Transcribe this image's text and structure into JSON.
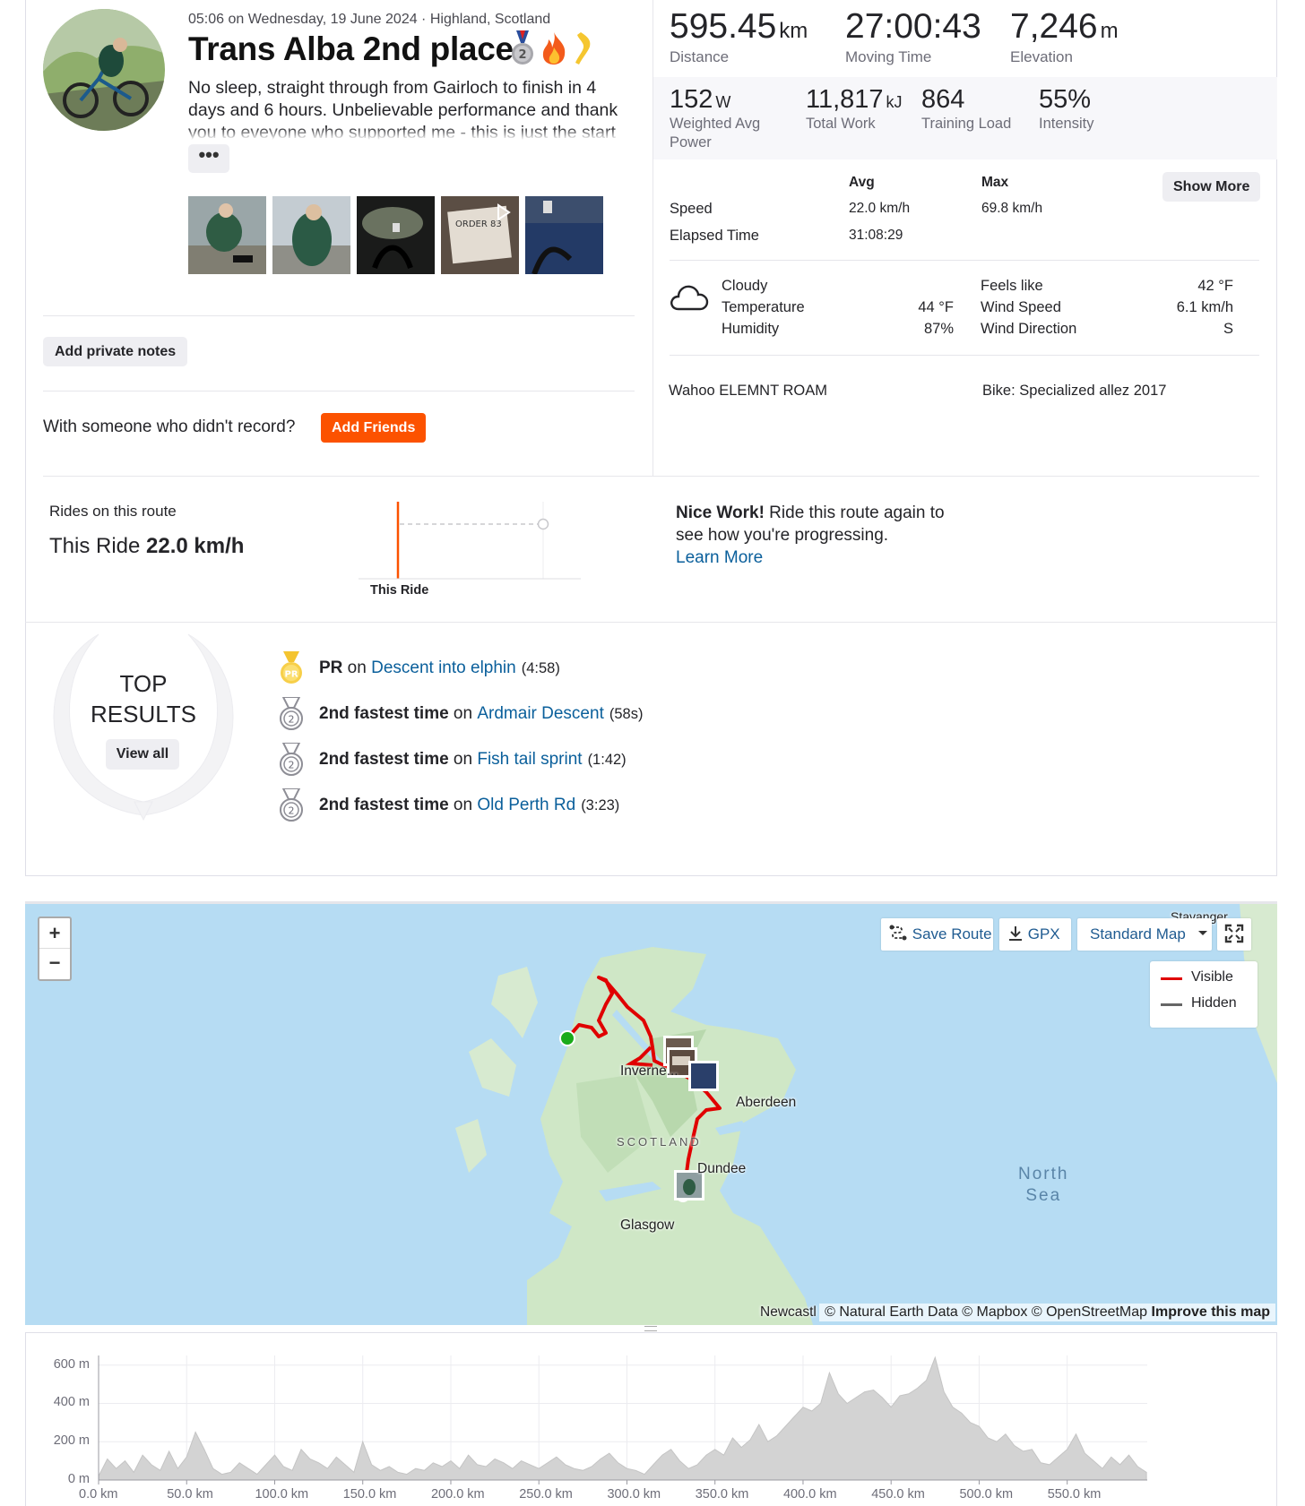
{
  "header": {
    "meta": "05:06 on Wednesday, 19 June 2024 · Highland, Scotland",
    "title": "Trans Alba 2nd place",
    "title_icons": [
      "silver-medal-2-icon",
      "fire-icon",
      "flexed-leg-icon"
    ],
    "description": "No sleep, straight through from Gairloch to finish in 4 days and 6 hours. Unbelievable performance and thank you to eveyone who supported me - this is just the start",
    "more_label": "•••",
    "photos": [
      "photo-rider-seated",
      "photo-rider-jacket",
      "photo-night-bars",
      "photo-order-83-video",
      "photo-loch-bars"
    ]
  },
  "actions": {
    "private_notes": "Add private notes",
    "with_someone": "With someone who didn't record?",
    "add_friends": "Add Friends"
  },
  "stats": {
    "primary": [
      {
        "value": "595.45",
        "unit": "km",
        "label": "Distance"
      },
      {
        "value": "27:00:43",
        "unit": "",
        "label": "Moving Time"
      },
      {
        "value": "7,246",
        "unit": "m",
        "label": "Elevation"
      }
    ],
    "secondary": [
      {
        "value": "152",
        "unit": "W",
        "label": "Weighted Avg Power"
      },
      {
        "value": "11,817",
        "unit": "kJ",
        "label": "Total Work"
      },
      {
        "value": "864",
        "unit": "",
        "label": "Training Load"
      },
      {
        "value": "55%",
        "unit": "",
        "label": "Intensity"
      }
    ],
    "table_headers": {
      "avg": "Avg",
      "max": "Max"
    },
    "show_more": "Show More",
    "speed": {
      "label": "Speed",
      "avg": "22.0 km/h",
      "max": "69.8 km/h"
    },
    "elapsed": {
      "label": "Elapsed Time",
      "avg": "31:08:29"
    }
  },
  "weather": {
    "icon": "cloud-icon",
    "condition": "Cloudy",
    "temperature_label": "Temperature",
    "temperature": "44 °F",
    "humidity_label": "Humidity",
    "humidity": "87%",
    "feels_like_label": "Feels like",
    "feels_like": "42 °F",
    "wind_speed_label": "Wind Speed",
    "wind_speed": "6.1 km/h",
    "wind_direction_label": "Wind Direction",
    "wind_direction": "S"
  },
  "gear": {
    "device": "Wahoo ELEMNT ROAM",
    "bike": "Bike: Specialized allez 2017"
  },
  "route": {
    "label": "Rides on this route",
    "this_ride_prefix": "This Ride",
    "this_ride_speed": "22.0 km/h",
    "chart_label": "This Ride",
    "nice_work_bold": "Nice Work!",
    "nice_work_text": " Ride this route again to see how you're progressing.",
    "learn_more": "Learn More"
  },
  "top_results": {
    "title_line1": "TOP",
    "title_line2": "RESULTS",
    "view_all": "View all",
    "items": [
      {
        "medal": "pr-medal-icon",
        "prefix": "PR",
        "on": " on ",
        "segment": "Descent into elphin",
        "time": "(4:58)"
      },
      {
        "medal": "second-place-medal-icon",
        "prefix": "2nd fastest time",
        "on": " on ",
        "segment": "Ardmair Descent",
        "time": "(58s)"
      },
      {
        "medal": "second-place-medal-icon",
        "prefix": "2nd fastest time",
        "on": " on ",
        "segment": "Fish tail sprint",
        "time": "(1:42)"
      },
      {
        "medal": "second-place-medal-icon",
        "prefix": "2nd fastest time",
        "on": " on ",
        "segment": "Old Perth Rd",
        "time": "(3:23)"
      }
    ]
  },
  "map": {
    "zoom_in": "+",
    "zoom_out": "−",
    "save_route": "Save Route",
    "gpx": "GPX",
    "map_style": "Standard Map",
    "legend_visible": "Visible",
    "legend_hidden": "Hidden",
    "places": {
      "inverness": "Inverne...",
      "aberdeen": "Aberdeen",
      "scotland": "SCOTLAND",
      "dundee": "Dundee",
      "glasgow": "Glasgow",
      "north_sea": "North\nSea",
      "stavanger": "Stavanger",
      "newcastle": "Newcastl"
    },
    "attribution": "© Natural Earth Data © Mapbox © OpenStreetMap",
    "improve": "Improve this map",
    "route_color": "#e00000",
    "hidden_color": "#666666"
  },
  "chart_data": {
    "type": "area",
    "title": "",
    "xlabel": "",
    "ylabel": "",
    "x_ticks": [
      "0.0 km",
      "50.0 km",
      "100.0 km",
      "150.0 km",
      "200.0 km",
      "250.0 km",
      "300.0 km",
      "350.0 km",
      "400.0 km",
      "450.0 km",
      "500.0 km",
      "550.0 km"
    ],
    "y_ticks": [
      "0 m",
      "200 m",
      "400 m",
      "600 m"
    ],
    "xlim": [
      0,
      595.45
    ],
    "ylim": [
      0,
      650
    ],
    "grid": true,
    "fill_color": "#d3d3d3",
    "series": [
      {
        "x": [
          0,
          5,
          10,
          15,
          20,
          25,
          30,
          35,
          40,
          45,
          50,
          55,
          60,
          65,
          70,
          75,
          80,
          85,
          90,
          95,
          100,
          105,
          110,
          115,
          120,
          125,
          130,
          135,
          140,
          145,
          150,
          155,
          160,
          165,
          170,
          175,
          180,
          185,
          190,
          195,
          200,
          205,
          210,
          215,
          220,
          225,
          230,
          235,
          240,
          245,
          250,
          255,
          260,
          265,
          270,
          275,
          280,
          285,
          290,
          295,
          300,
          305,
          310,
          315,
          320,
          325,
          330,
          335,
          340,
          345,
          350,
          355,
          360,
          365,
          370,
          375,
          380,
          385,
          390,
          395,
          400,
          405,
          410,
          415,
          420,
          425,
          430,
          435,
          440,
          445,
          450,
          455,
          460,
          465,
          470,
          475,
          480,
          485,
          490,
          495,
          500,
          505,
          510,
          515,
          520,
          525,
          530,
          535,
          540,
          545,
          550,
          555,
          560,
          565,
          570,
          575,
          580,
          585,
          590,
          595
        ],
        "y": [
          20,
          110,
          60,
          100,
          40,
          130,
          80,
          50,
          150,
          60,
          120,
          250,
          160,
          60,
          30,
          40,
          90,
          60,
          30,
          80,
          130,
          70,
          50,
          160,
          110,
          90,
          60,
          120,
          80,
          40,
          200,
          80,
          50,
          70,
          40,
          30,
          60,
          50,
          90,
          70,
          100,
          60,
          130,
          80,
          70,
          110,
          90,
          60,
          100,
          80,
          60,
          90,
          120,
          80,
          60,
          50,
          70,
          110,
          140,
          90,
          60,
          50,
          30,
          80,
          130,
          160,
          100,
          60,
          80,
          130,
          160,
          130,
          220,
          170,
          210,
          290,
          200,
          230,
          280,
          330,
          380,
          360,
          400,
          560,
          450,
          400,
          430,
          460,
          470,
          430,
          380,
          440,
          450,
          480,
          520,
          640,
          460,
          380,
          350,
          300,
          280,
          220,
          200,
          240,
          180,
          150,
          160,
          90,
          80,
          120,
          160,
          240,
          140,
          100,
          60,
          120,
          80,
          130,
          70,
          40
        ]
      }
    ]
  }
}
